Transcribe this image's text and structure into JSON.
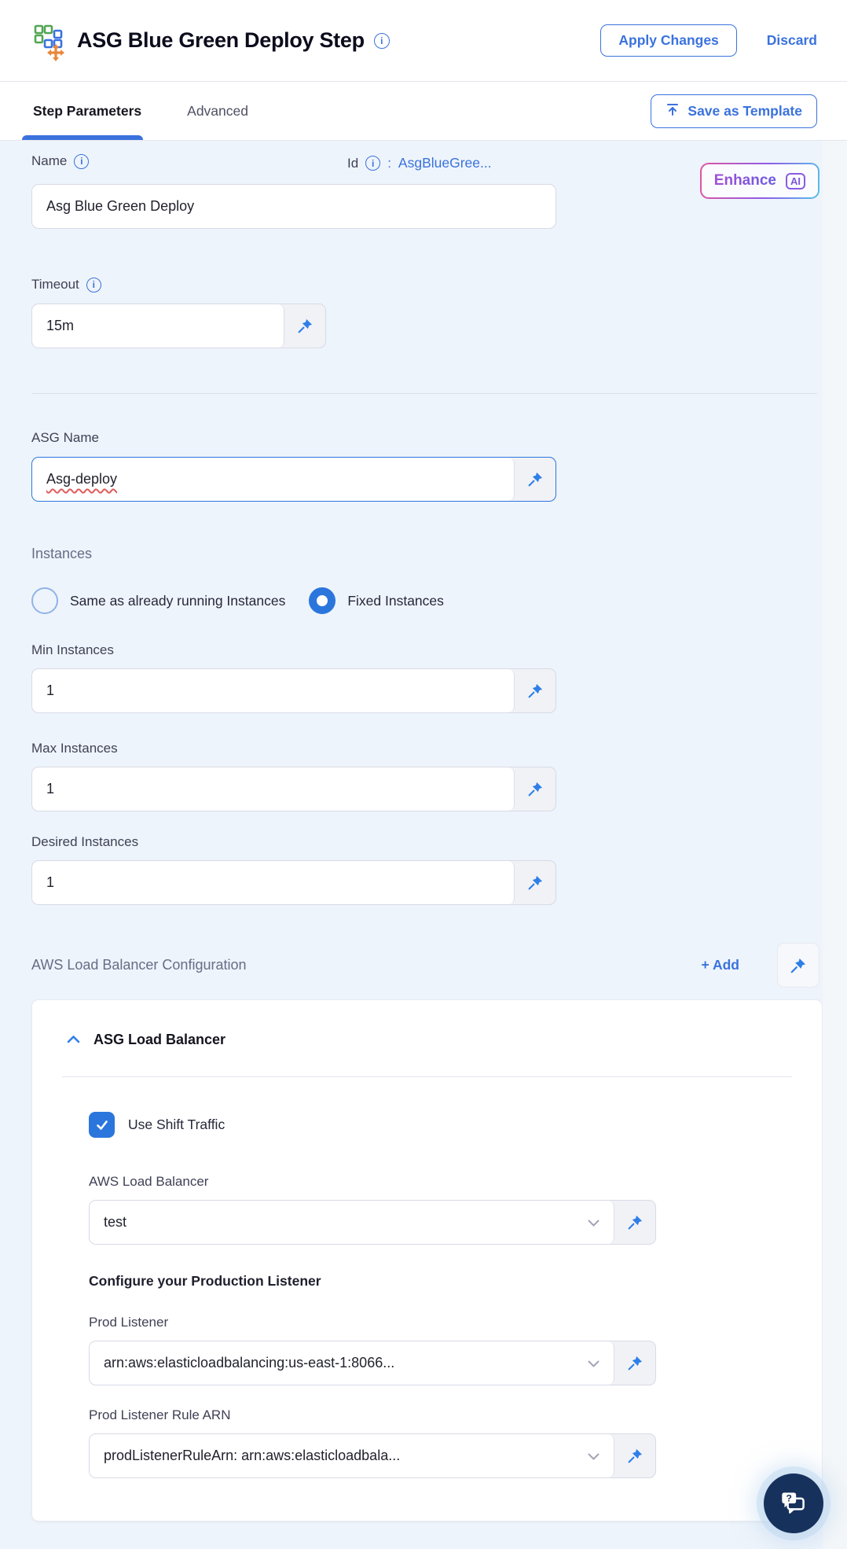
{
  "header": {
    "title": "ASG Blue Green Deploy Step",
    "apply_label": "Apply Changes",
    "discard_label": "Discard"
  },
  "tabs": {
    "step_parameters": "Step Parameters",
    "advanced": "Advanced",
    "save_as_template": "Save as Template"
  },
  "form": {
    "name": {
      "label": "Name",
      "value": "Asg Blue Green Deploy"
    },
    "id": {
      "label": "Id",
      "separator": ":",
      "value": "AsgBlueGree..."
    },
    "enhance": {
      "label": "Enhance",
      "badge": "AI"
    },
    "timeout": {
      "label": "Timeout",
      "value": "15m"
    },
    "asg_name": {
      "label": "ASG Name",
      "value": "Asg-deploy"
    },
    "instances": {
      "heading": "Instances",
      "options": [
        {
          "label": "Same as already running Instances",
          "selected": false
        },
        {
          "label": "Fixed Instances",
          "selected": true
        }
      ]
    },
    "min_instances": {
      "label": "Min Instances",
      "value": "1"
    },
    "max_instances": {
      "label": "Max Instances",
      "value": "1"
    },
    "desired_instances": {
      "label": "Desired Instances",
      "value": "1"
    },
    "lb_config": {
      "heading": "AWS Load Balancer Configuration",
      "add_label": "+ Add"
    },
    "lb_card": {
      "title": "ASG Load Balancer",
      "use_shift_traffic": {
        "label": "Use Shift Traffic",
        "checked": true
      },
      "aws_load_balancer": {
        "label": "AWS Load Balancer",
        "value": "test"
      },
      "configure_heading": "Configure your Production Listener",
      "prod_listener": {
        "label": "Prod Listener",
        "value": "arn:aws:elasticloadbalancing:us-east-1:8066..."
      },
      "prod_listener_rule": {
        "label": "Prod Listener Rule ARN",
        "value": "prodListenerRuleArn: arn:aws:elasticloadbala..."
      }
    }
  },
  "colors": {
    "primary_blue": "#3a72dd",
    "pin_blue": "#2e7fe8",
    "page_background": "#eef4fb",
    "chat_navy": "#16325c",
    "enhance_gradient": [
      "#e0559f",
      "#8e5ce8",
      "#55c0ea"
    ]
  }
}
